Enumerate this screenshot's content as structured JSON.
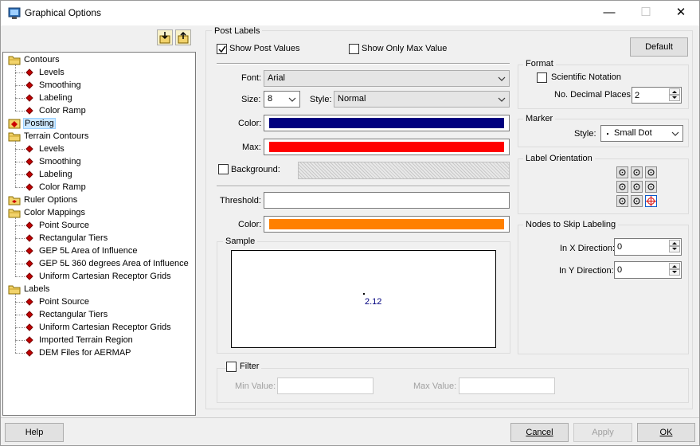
{
  "window": {
    "title": "Graphical Options"
  },
  "tree": {
    "items": [
      {
        "label": "Contours",
        "level": 0,
        "icon": "folder-icon"
      },
      {
        "label": "Levels",
        "level": 1,
        "icon": "diamond-icon"
      },
      {
        "label": "Smoothing",
        "level": 1,
        "icon": "diamond-icon"
      },
      {
        "label": "Labeling",
        "level": 1,
        "icon": "diamond-icon"
      },
      {
        "label": "Color Ramp",
        "level": 1,
        "icon": "diamond-icon"
      },
      {
        "label": "Posting",
        "level": 0,
        "icon": "posting-icon",
        "selected": true
      },
      {
        "label": "Terrain Contours",
        "level": 0,
        "icon": "folder-icon"
      },
      {
        "label": "Levels",
        "level": 1,
        "icon": "diamond-icon"
      },
      {
        "label": "Smoothing",
        "level": 1,
        "icon": "diamond-icon"
      },
      {
        "label": "Labeling",
        "level": 1,
        "icon": "diamond-icon"
      },
      {
        "label": "Color Ramp",
        "level": 1,
        "icon": "diamond-icon"
      },
      {
        "label": "Ruler Options",
        "level": 0,
        "icon": "ruler-folder-icon"
      },
      {
        "label": "Color Mappings",
        "level": 0,
        "icon": "folder-icon"
      },
      {
        "label": "Point Source",
        "level": 1,
        "icon": "diamond-icon"
      },
      {
        "label": "Rectangular Tiers",
        "level": 1,
        "icon": "diamond-icon"
      },
      {
        "label": "GEP 5L Area of Influence",
        "level": 1,
        "icon": "diamond-icon"
      },
      {
        "label": "GEP 5L 360 degrees Area of Influence",
        "level": 1,
        "icon": "diamond-icon"
      },
      {
        "label": "Uniform Cartesian Receptor Grids",
        "level": 1,
        "icon": "diamond-icon"
      },
      {
        "label": "Labels",
        "level": 0,
        "icon": "folder-icon"
      },
      {
        "label": "Point Source",
        "level": 1,
        "icon": "diamond-icon"
      },
      {
        "label": "Rectangular Tiers",
        "level": 1,
        "icon": "diamond-icon"
      },
      {
        "label": "Uniform Cartesian Receptor Grids",
        "level": 1,
        "icon": "diamond-icon"
      },
      {
        "label": "Imported Terrain Region",
        "level": 1,
        "icon": "diamond-icon"
      },
      {
        "label": "DEM Files for AERMAP",
        "level": 1,
        "icon": "diamond-icon"
      }
    ]
  },
  "post_labels": {
    "group_title": "Post Labels",
    "show_post_values": {
      "label": "Show Post Values",
      "checked": true
    },
    "show_only_max": {
      "label": "Show Only Max Value",
      "checked": false
    },
    "default_button": "Default",
    "font_label": "Font:",
    "font_value": "Arial",
    "size_label": "Size:",
    "size_value": "8",
    "style_label": "Style:",
    "style_value": "Normal",
    "color_label": "Color:",
    "color_value": "#00007f",
    "max_label": "Max:",
    "max_color": "#ff0000",
    "background_label": "Background:",
    "threshold_label": "Threshold:",
    "threshold_value": "",
    "threshold_color_label": "Color:",
    "threshold_color": "#ff8000",
    "sample_title": "Sample",
    "sample_value": "2.12"
  },
  "format": {
    "title": "Format",
    "scientific_label": "Scientific Notation",
    "decimal_label": "No. Decimal Places:",
    "decimal_value": "2"
  },
  "marker": {
    "title": "Marker",
    "style_label": "Style:",
    "style_value": "Small Dot"
  },
  "label_orientation": {
    "title": "Label Orientation",
    "selected": "bottom-right"
  },
  "nodes_skip": {
    "title": "Nodes to Skip Labeling",
    "x_label": "In X Direction:",
    "x_value": "0",
    "y_label": "In Y Direction:",
    "y_value": "0"
  },
  "filter": {
    "label": "Filter",
    "min_label": "Min Value:",
    "max_label": "Max Value:"
  },
  "buttons": {
    "help": "Help",
    "cancel": "Cancel",
    "apply": "Apply",
    "ok": "OK"
  }
}
